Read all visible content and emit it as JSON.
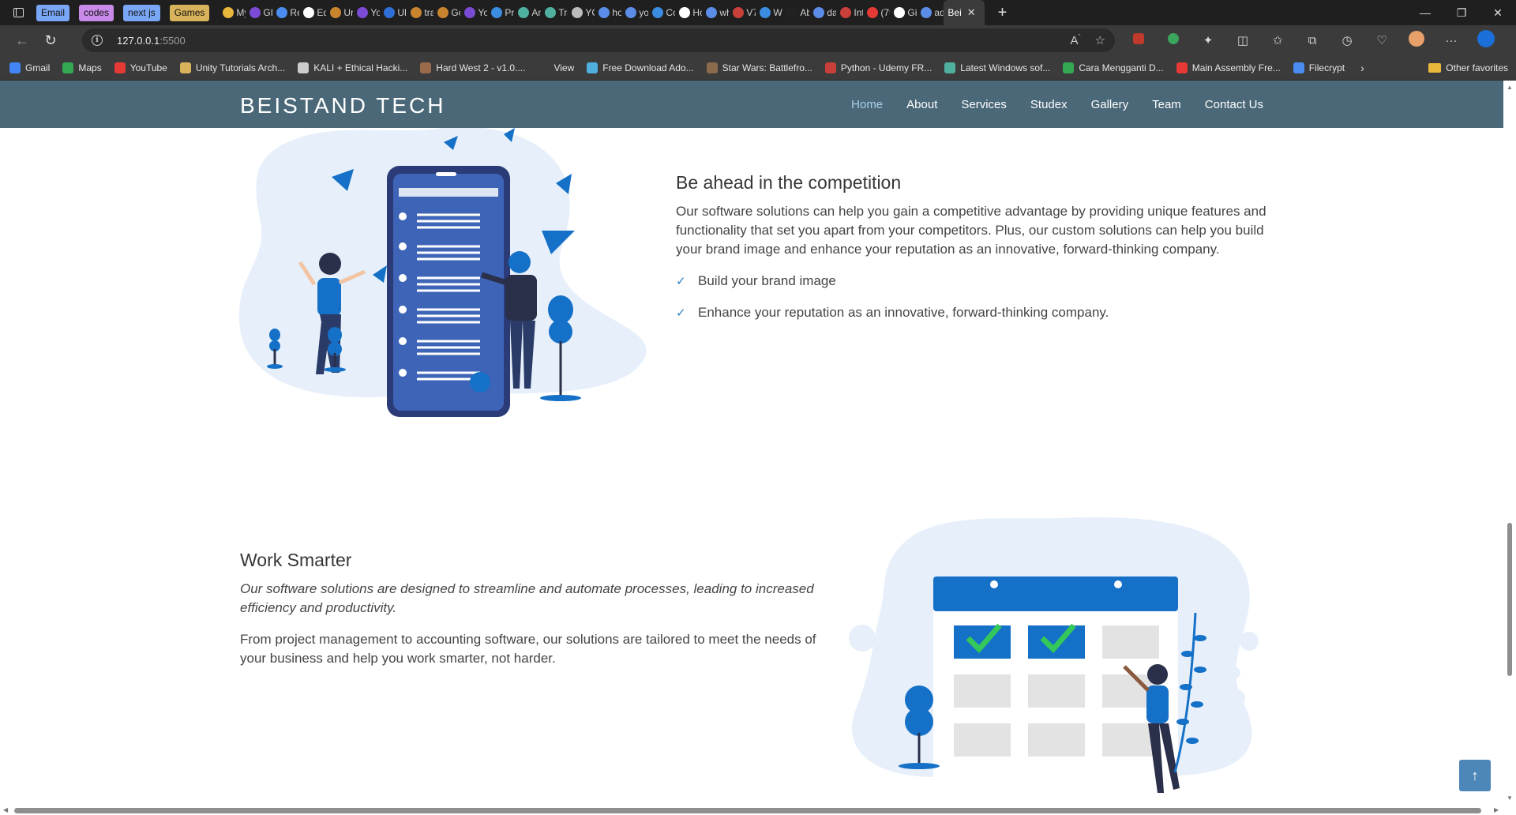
{
  "browser": {
    "tab_groups": [
      {
        "label": "Email",
        "color": "#7aa7f5"
      },
      {
        "label": "codes",
        "color": "#c78ae8"
      },
      {
        "label": "next js",
        "color": "#7aa7f5"
      },
      {
        "label": "Games",
        "color": "#d9b35b"
      }
    ],
    "tabs": [
      {
        "label": "My",
        "color": "#e8b73b"
      },
      {
        "label": "GF",
        "color": "#7b4bd6"
      },
      {
        "label": "Re",
        "color": "#4a8cf0"
      },
      {
        "label": "Ed",
        "color": "#ffffff"
      },
      {
        "label": "Ur",
        "color": "#c9842e"
      },
      {
        "label": "Yo",
        "color": "#7b4bd6"
      },
      {
        "label": "Ul",
        "color": "#2e70d6"
      },
      {
        "label": "tra",
        "color": "#c9842e"
      },
      {
        "label": "Go",
        "color": "#c9842e"
      },
      {
        "label": "Yo",
        "color": "#7b4bd6"
      },
      {
        "label": "Pri",
        "color": "#3a8de0"
      },
      {
        "label": "An",
        "color": "#4fb0a0"
      },
      {
        "label": "Tra",
        "color": "#4fb0a0"
      },
      {
        "label": "YC",
        "color": "#bbbbbb"
      },
      {
        "label": "ho",
        "color": "#5b8de8"
      },
      {
        "label": "yo",
        "color": "#5b8de8"
      },
      {
        "label": "Co",
        "color": "#3a8de0"
      },
      {
        "label": "Ho",
        "color": "#ffffff"
      },
      {
        "label": "wh",
        "color": "#5b8de8"
      },
      {
        "label": "V7",
        "color": "#c9403a"
      },
      {
        "label": "Wi",
        "color": "#3a8de0"
      },
      {
        "label": "Ab",
        "color": "#222222"
      },
      {
        "label": "da",
        "color": "#5b8de8"
      },
      {
        "label": "Int",
        "color": "#c9403a"
      },
      {
        "label": "(79",
        "color": "#e53935"
      },
      {
        "label": "Gi",
        "color": "#ffffff"
      },
      {
        "label": "ad",
        "color": "#5b8de8"
      }
    ],
    "active_tab": "Bei",
    "new_tab_icon": "plus-icon",
    "url_host": "127.0.0.1",
    "url_port": ":5500",
    "bookmarks": [
      {
        "label": "Gmail",
        "color": "#4285f4"
      },
      {
        "label": "Maps",
        "color": "#34a853"
      },
      {
        "label": "YouTube",
        "color": "#e53935"
      },
      {
        "label": "Unity Tutorials Arch...",
        "color": "#d9b35b"
      },
      {
        "label": "KALI + Ethical Hacki...",
        "color": "#cccccc"
      },
      {
        "label": "Hard West 2 - v1.0....",
        "color": "#9a6b4b"
      },
      {
        "label": "View",
        "color": "#3b3b3b"
      },
      {
        "label": "Free Download Ado...",
        "color": "#4fb0e0"
      },
      {
        "label": "Star Wars: Battlefro...",
        "color": "#8a6b4b"
      },
      {
        "label": "Python - Udemy FR...",
        "color": "#c9403a"
      },
      {
        "label": "Latest Windows sof...",
        "color": "#4fb0a0"
      },
      {
        "label": "Cara Mengganti D...",
        "color": "#34a853"
      },
      {
        "label": "Main Assembly Fre...",
        "color": "#e53935"
      },
      {
        "label": "Filecrypt",
        "color": "#4a8cf0"
      }
    ],
    "other_favorites": "Other favorites"
  },
  "site": {
    "brand": "BEISTAND TECH",
    "nav": [
      "Home",
      "About",
      "Services",
      "Studex",
      "Gallery",
      "Team",
      "Contact Us"
    ]
  },
  "section1": {
    "title": "Be ahead in the competition",
    "body": "Our software solutions can help you gain a competitive advantage by providing unique features and functionality that set you apart from your competitors. Plus, our custom solutions can help you build your brand image and enhance your reputation as an innovative, forward-thinking company.",
    "bullets": [
      "Build your brand image",
      "Enhance your reputation as an innovative, forward-thinking company."
    ]
  },
  "section2": {
    "title": "Work Smarter",
    "lead": "Our software solutions are designed to streamline and automate processes, leading to increased efficiency and productivity.",
    "body": "From project management to accounting software, our solutions are tailored to meet the needs of your business and help you work smarter, not harder."
  },
  "colors": {
    "header_bg": "#4a6878",
    "accent": "#1570c7",
    "check": "#2a7fbf",
    "totop": "#4d86b9"
  }
}
